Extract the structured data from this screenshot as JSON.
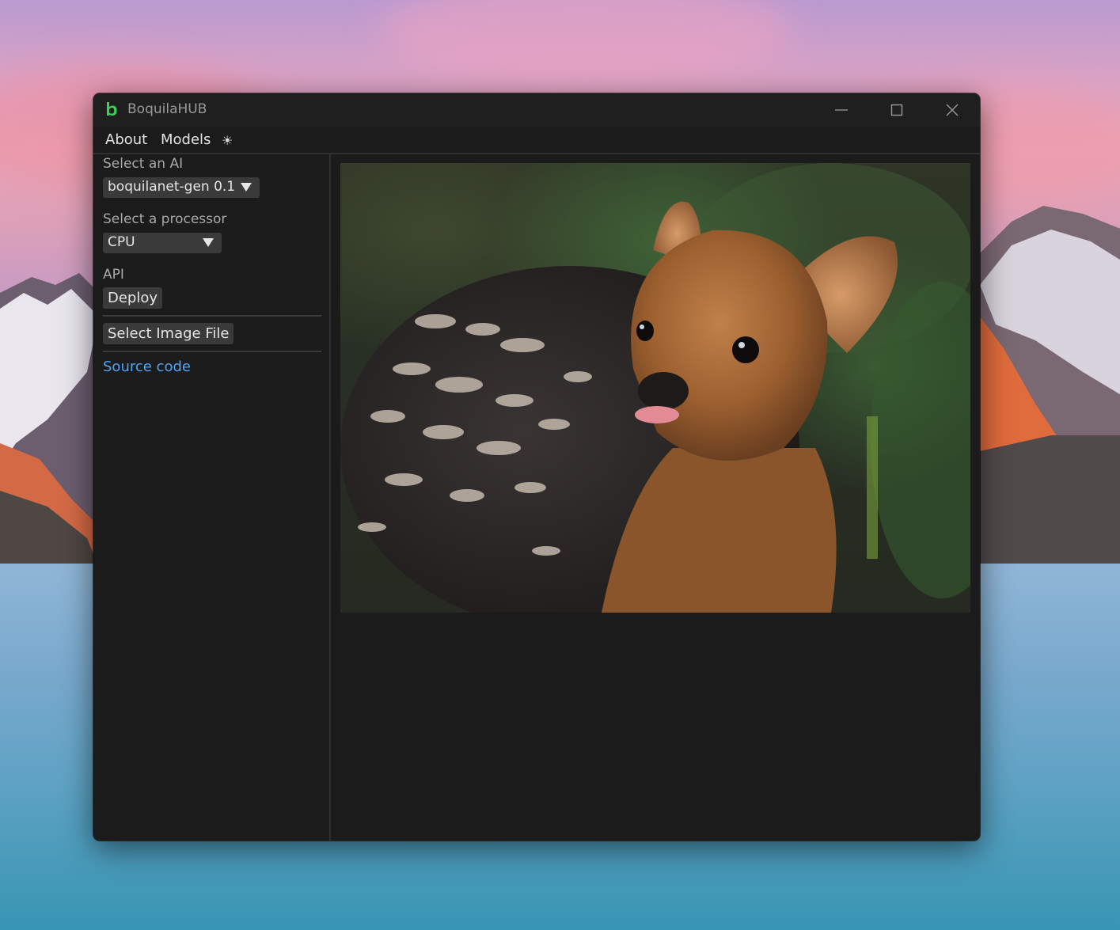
{
  "window": {
    "title": "BoquilaHUB"
  },
  "menu": {
    "about": "About",
    "models": "Models",
    "theme_toggle_icon": "sun-icon",
    "theme_toggle_glyph": "☀"
  },
  "sidebar": {
    "ai_label": "Select an AI",
    "ai_selected": "boquilanet-gen 0.1",
    "processor_label": "Select a processor",
    "processor_selected": "CPU",
    "api_label": "API",
    "deploy_button": "Deploy",
    "select_image_button": "Select Image File",
    "source_code_link": "Source code"
  },
  "main": {
    "preview_image": "pudu-deer-photo"
  },
  "colors": {
    "accent_green": "#3ecf5a",
    "link_blue": "#4fa3f0",
    "window_bg": "#1b1b1b",
    "control_bg": "#3a3a3a"
  }
}
